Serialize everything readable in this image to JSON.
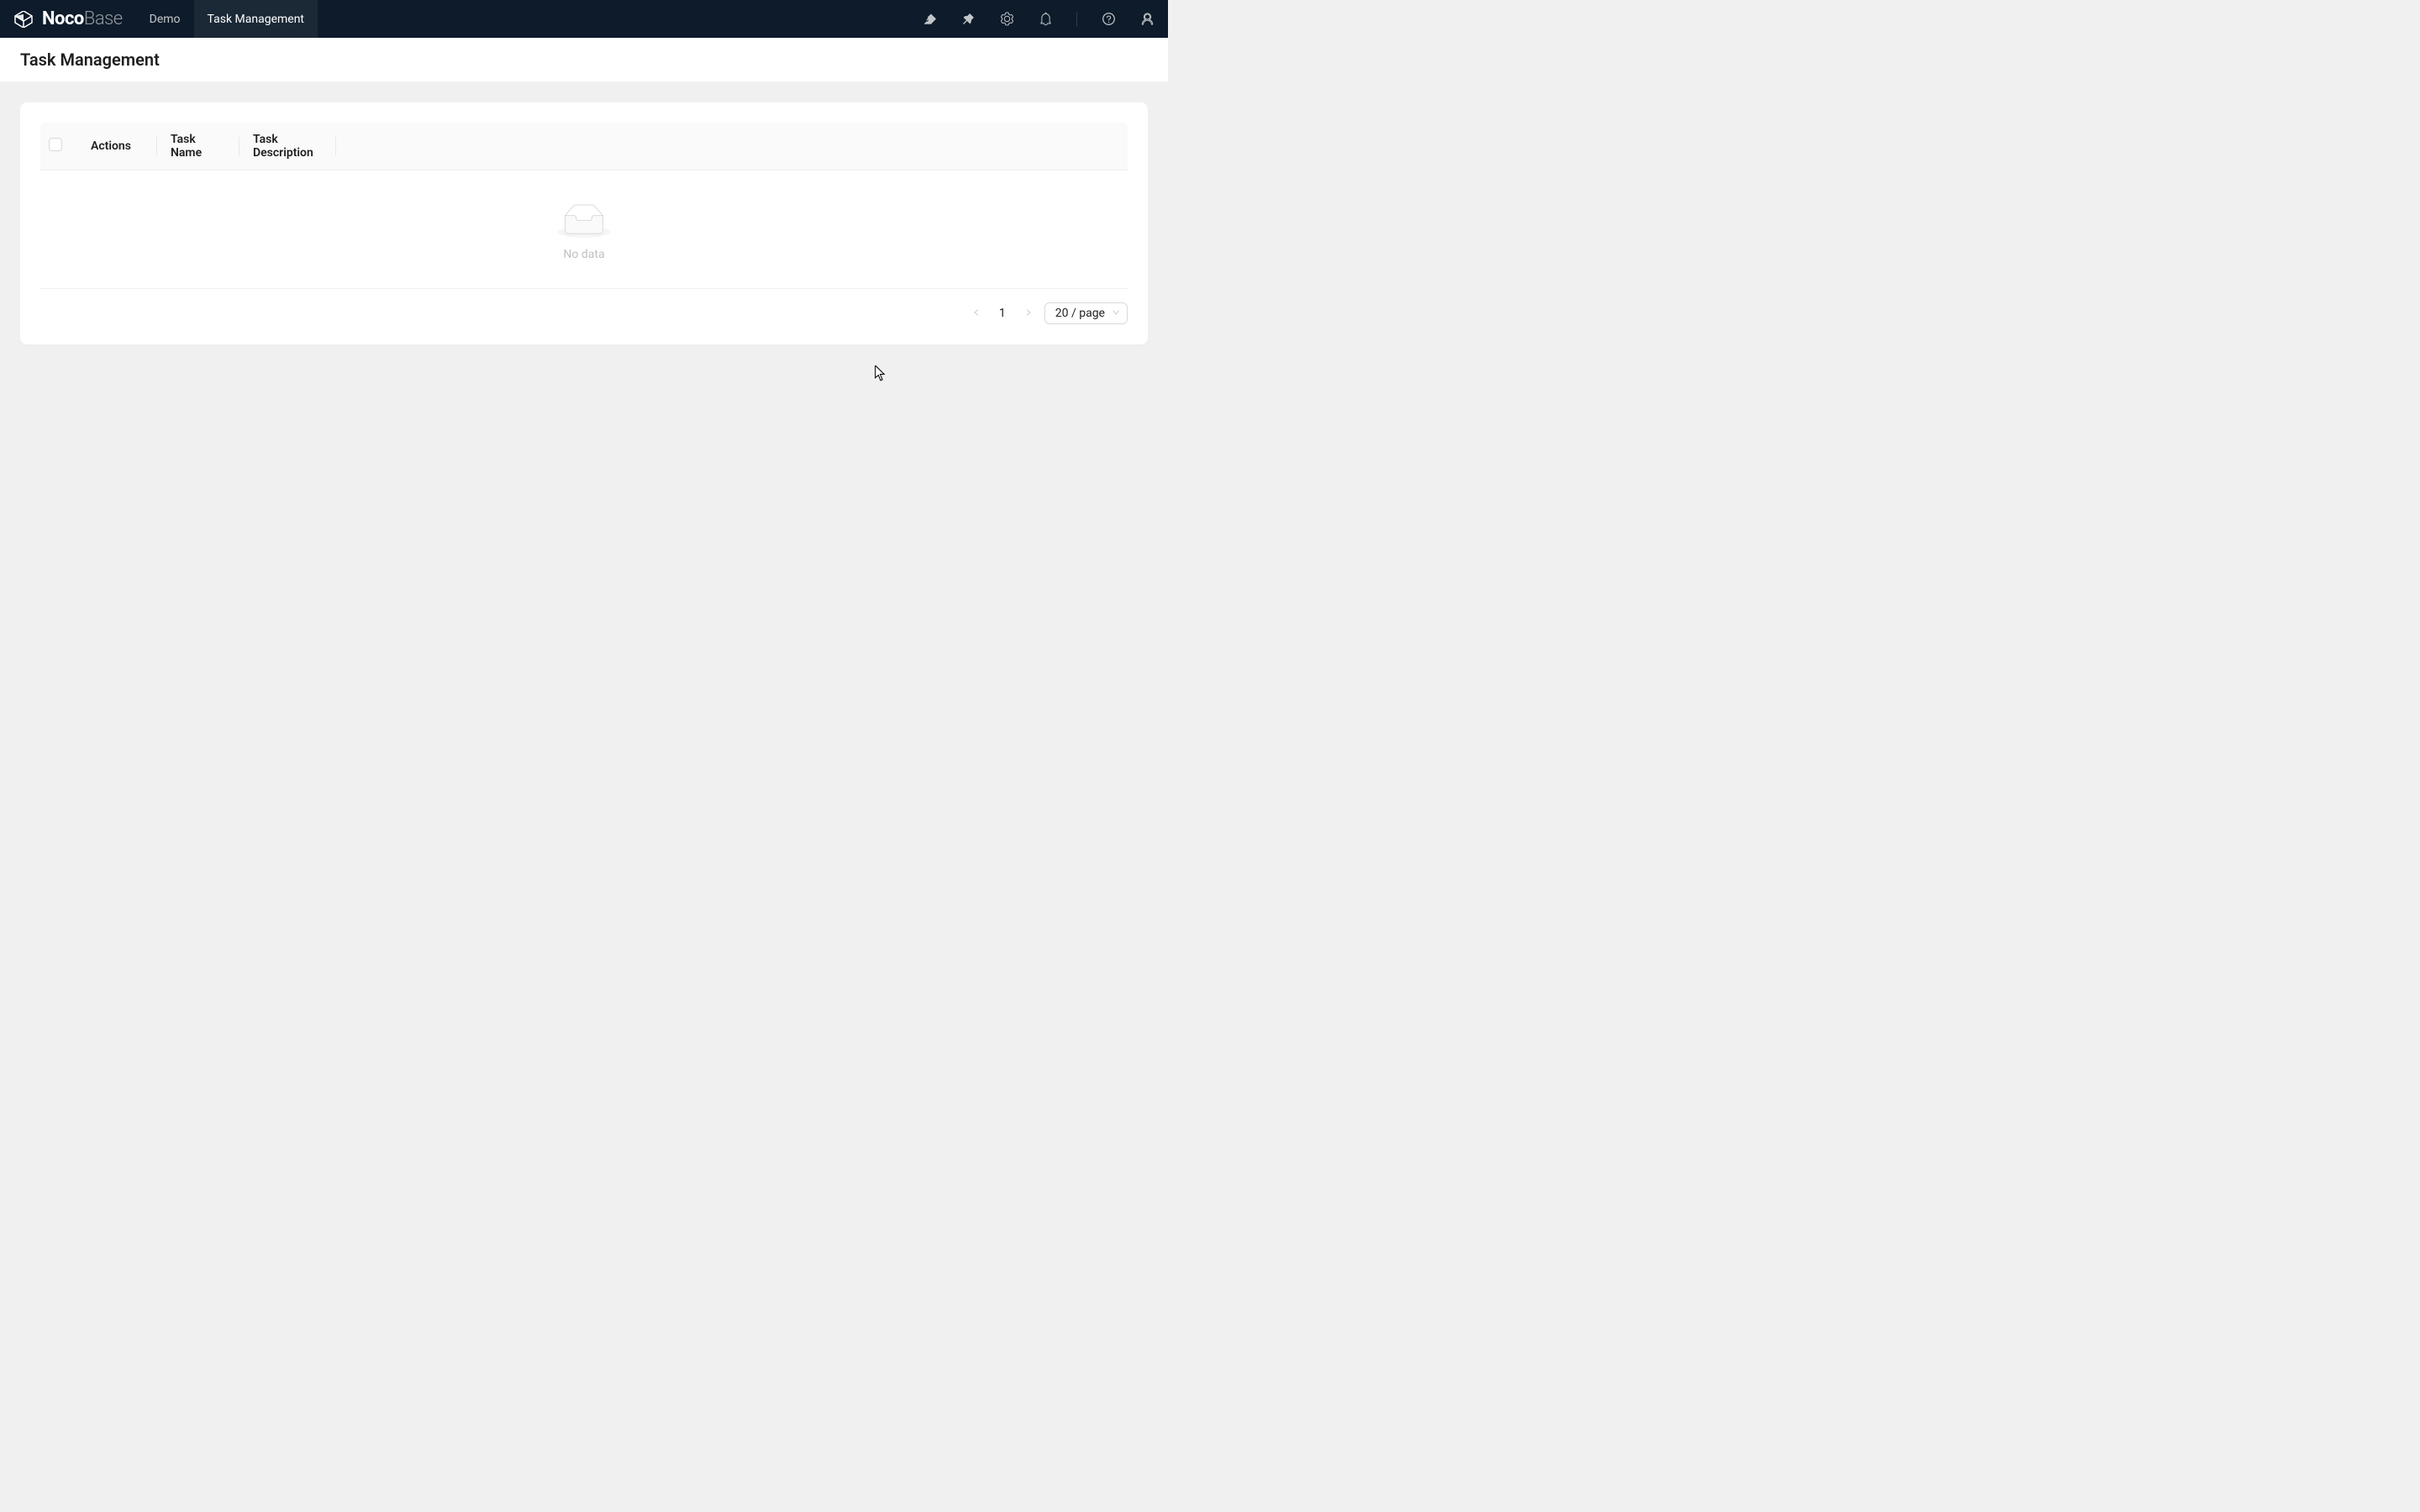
{
  "header": {
    "brand_bold": "Noco",
    "brand_light": "Base",
    "nav": [
      {
        "label": "Demo",
        "active": false
      },
      {
        "label": "Task Management",
        "active": true
      }
    ]
  },
  "page": {
    "title": "Task Management"
  },
  "table": {
    "columns": {
      "actions": "Actions",
      "task_name": "Task Name",
      "task_description": "Task Description"
    },
    "empty_text": "No data"
  },
  "pagination": {
    "current": "1",
    "page_size": "20 / page"
  }
}
